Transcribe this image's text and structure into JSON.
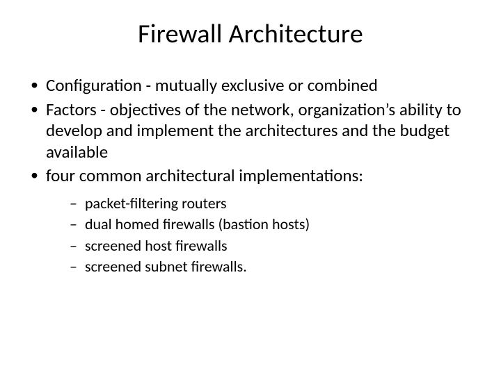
{
  "title": "Firewall Architecture",
  "bullets": [
    "Configuration - mutually exclusive or combined",
    "Factors - objectives of the network, organization’s ability to develop and implement the architectures and the budget available",
    "four common architectural implementations:"
  ],
  "sub_bullets": [
    "packet-filtering routers",
    "dual homed firewalls (bastion hosts)",
    "screened host firewalls",
    "screened subnet firewalls."
  ]
}
